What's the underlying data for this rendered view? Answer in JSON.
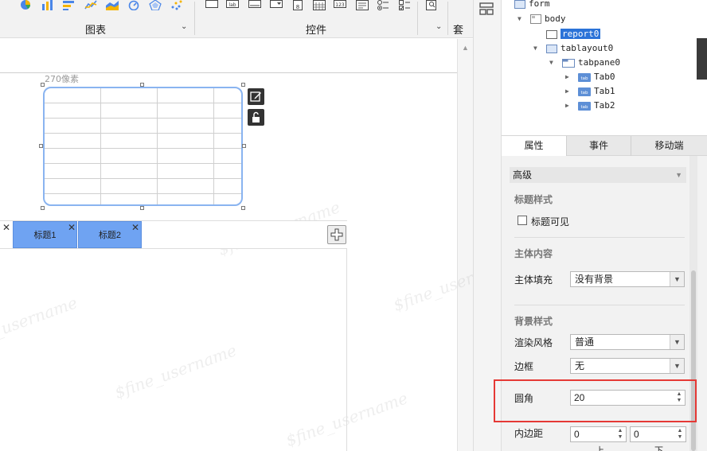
{
  "toolbar": {
    "groups": [
      {
        "label": "图表"
      },
      {
        "label": "控件"
      },
      {
        "label": "套用"
      }
    ],
    "chart_icons": [
      "pie-chart-icon",
      "bar-chart-icon",
      "horizontal-bar-icon",
      "line-chart-icon",
      "area-chart-icon",
      "gauge-chart-icon",
      "radar-chart-icon",
      "scatter-chart-icon"
    ],
    "widget_icons": [
      {
        "name": "button-widget-icon",
        "text": ""
      },
      {
        "name": "label-widget-icon",
        "text": "lab"
      },
      {
        "name": "text-field-widget-icon",
        "text": ""
      },
      {
        "name": "dropdown-widget-icon",
        "text": ""
      },
      {
        "name": "date-widget-icon",
        "text": "8"
      },
      {
        "name": "calendar-widget-icon",
        "text": ""
      },
      {
        "name": "number-widget-icon",
        "text": "123"
      },
      {
        "name": "text-area-widget-icon",
        "text": ""
      },
      {
        "name": "radio-widget-icon",
        "text": ""
      },
      {
        "name": "checkbox-widget-icon",
        "text": ""
      },
      {
        "name": "search-widget-icon",
        "text": ""
      }
    ]
  },
  "canvas": {
    "size_label": "270像素",
    "tabs": [
      {
        "label": "标题1"
      },
      {
        "label": "标题2"
      }
    ],
    "close_glyph": "✕",
    "watermark": "$fine_username"
  },
  "tree": {
    "nodes": [
      {
        "label": "form"
      },
      {
        "label": "body"
      },
      {
        "label": "report0"
      },
      {
        "label": "tablayout0"
      },
      {
        "label": "tabpane0"
      },
      {
        "label": "Tab0"
      },
      {
        "label": "Tab1"
      },
      {
        "label": "Tab2"
      }
    ],
    "tab_icon_text": "tab"
  },
  "properties": {
    "tabs": [
      {
        "label": "属性"
      },
      {
        "label": "事件"
      },
      {
        "label": "移动端"
      }
    ],
    "mode": "高级",
    "title_style": {
      "heading": "标题样式",
      "visible_label": "标题可见",
      "visible_checked": false
    },
    "body_content": {
      "heading": "主体内容",
      "fill_label": "主体填充",
      "fill_value": "没有背景"
    },
    "background_style": {
      "heading": "背景样式",
      "render_label": "渲染风格",
      "render_value": "普通",
      "border_label": "边框",
      "border_value": "无",
      "radius_label": "圆角",
      "radius_value": "20",
      "padding_label": "内边距",
      "padding_top": "0",
      "padding_bottom": "0",
      "padding_sub_top": "上",
      "padding_sub_bottom": "下"
    }
  },
  "colors": {
    "accent": "#2b73d8",
    "tab_fill": "#6fa3f2",
    "selection_border": "#8ab4f0",
    "highlight": "#e53935"
  }
}
